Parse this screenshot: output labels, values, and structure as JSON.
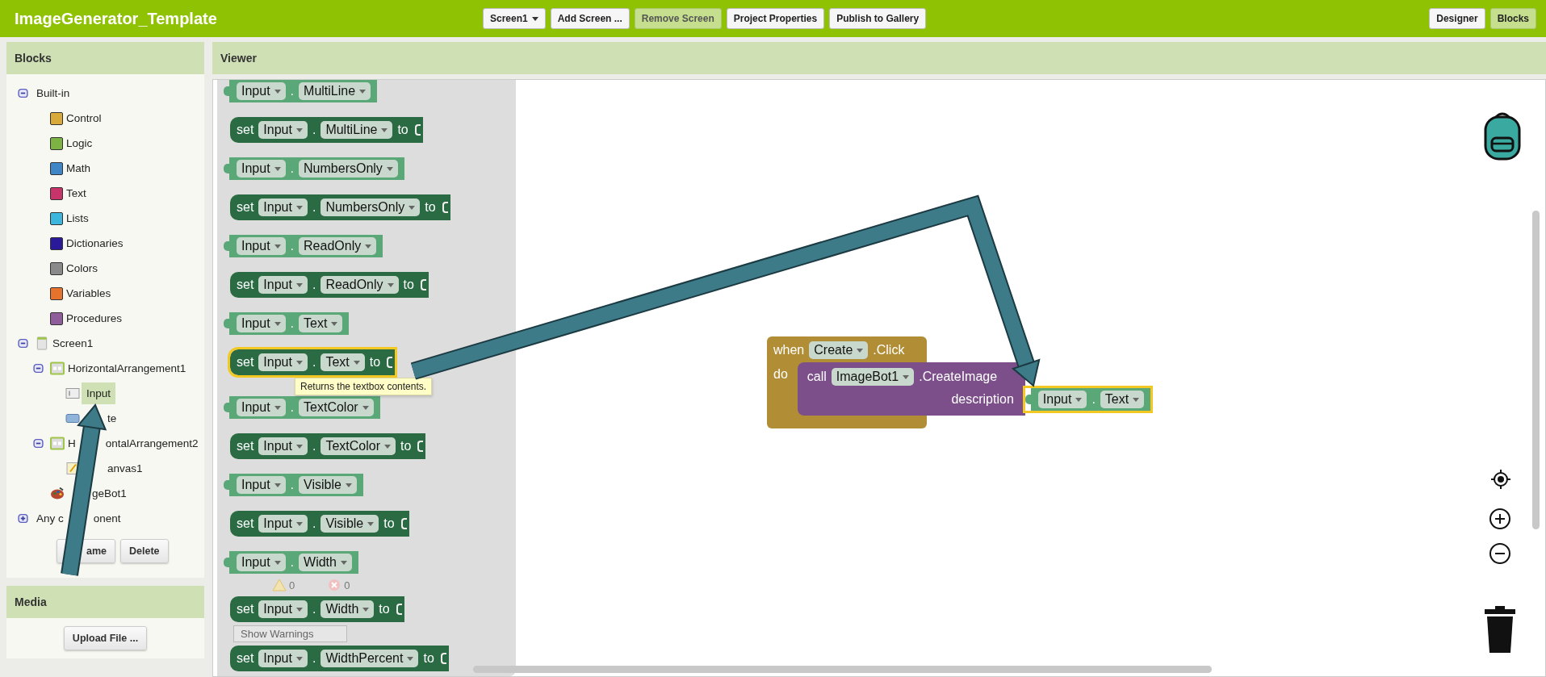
{
  "app_title": "ImageGenerator_Template",
  "toolbar": [
    {
      "label": "Screen1",
      "kind": "dropdown",
      "disabled": false
    },
    {
      "label": "Add Screen ...",
      "kind": "button",
      "disabled": false
    },
    {
      "label": "Remove Screen",
      "kind": "button",
      "disabled": true
    },
    {
      "label": "Project Properties",
      "kind": "button",
      "disabled": false
    },
    {
      "label": "Publish to Gallery",
      "kind": "button",
      "disabled": false
    }
  ],
  "view_switch": [
    {
      "label": "Designer",
      "selected": false
    },
    {
      "label": "Blocks",
      "selected": true
    }
  ],
  "blocks_panel": {
    "title": "Blocks",
    "tree": [
      {
        "label": "Built-in",
        "kind": "group",
        "expanded": true,
        "children": [
          {
            "label": "Control",
            "kind": "category",
            "color": "#d9a93a"
          },
          {
            "label": "Logic",
            "kind": "category",
            "color": "#7cb342"
          },
          {
            "label": "Math",
            "kind": "category",
            "color": "#3f86c6"
          },
          {
            "label": "Text",
            "kind": "category",
            "color": "#c8336a"
          },
          {
            "label": "Lists",
            "kind": "category",
            "color": "#3db6dd"
          },
          {
            "label": "Dictionaries",
            "kind": "category",
            "color": "#2a1a99"
          },
          {
            "label": "Colors",
            "kind": "category",
            "color": "#8a8a8a"
          },
          {
            "label": "Variables",
            "kind": "category",
            "color": "#e6722c"
          },
          {
            "label": "Procedures",
            "kind": "category",
            "color": "#8e5d9a"
          }
        ]
      },
      {
        "label": "Screen1",
        "kind": "screen",
        "expanded": true,
        "selected": false,
        "children": [
          {
            "label": "HorizontalArrangement1",
            "kind": "arrangement",
            "expanded": true,
            "selected": false,
            "children": [
              {
                "label": "Input",
                "kind": "textbox",
                "selected": true
              },
              {
                "label": "te",
                "kind": "button",
                "selected": false,
                "covered_start": true
              }
            ]
          },
          {
            "label": "H",
            "label_rest": "ontalArrangement2",
            "kind": "arrangement",
            "expanded": true,
            "selected": false,
            "children": [
              {
                "label": "anvas1",
                "kind": "canvas",
                "selected": false,
                "covered_start": true
              }
            ]
          },
          {
            "label": "geBot1",
            "kind": "imagebot",
            "selected": false,
            "covered_start": true
          }
        ]
      },
      {
        "label": "Any c",
        "label_rest": "onent",
        "kind": "group",
        "expanded": false
      }
    ],
    "buttons": [
      {
        "label": "ame",
        "covered_start": true
      },
      {
        "label": "Delete",
        "covered_start": false
      }
    ]
  },
  "media_panel": {
    "title": "Media",
    "button": "Upload File ..."
  },
  "viewer": {
    "title": "Viewer",
    "flyout": [
      {
        "kind": "getter",
        "component": "Input",
        "dot": ".",
        "property": "MultiLine",
        "highlighted": false
      },
      {
        "kind": "setter",
        "verb": "set",
        "component": "Input",
        "dot": ".",
        "property": "MultiLine",
        "to": "to",
        "highlighted": false
      },
      {
        "kind": "getter",
        "component": "Input",
        "dot": ".",
        "property": "NumbersOnly",
        "highlighted": false
      },
      {
        "kind": "setter",
        "verb": "set",
        "component": "Input",
        "dot": ".",
        "property": "NumbersOnly",
        "to": "to",
        "highlighted": false
      },
      {
        "kind": "getter",
        "component": "Input",
        "dot": ".",
        "property": "ReadOnly",
        "highlighted": false
      },
      {
        "kind": "setter",
        "verb": "set",
        "component": "Input",
        "dot": ".",
        "property": "ReadOnly",
        "to": "to",
        "highlighted": false
      },
      {
        "kind": "getter",
        "component": "Input",
        "dot": ".",
        "property": "Text",
        "highlighted": false
      },
      {
        "kind": "setter",
        "verb": "set",
        "component": "Input",
        "dot": ".",
        "property": "Text",
        "to": "to",
        "highlighted": true,
        "tooltip": "Returns the textbox contents."
      },
      {
        "kind": "getter",
        "component": "Input",
        "dot": ".",
        "property": "TextColor",
        "highlighted": false
      },
      {
        "kind": "setter",
        "verb": "set",
        "component": "Input",
        "dot": ".",
        "property": "TextColor",
        "to": "to",
        "highlighted": false
      },
      {
        "kind": "getter",
        "component": "Input",
        "dot": ".",
        "property": "Visible",
        "highlighted": false
      },
      {
        "kind": "setter",
        "verb": "set",
        "component": "Input",
        "dot": ".",
        "property": "Visible",
        "to": "to",
        "highlighted": false
      },
      {
        "kind": "getter",
        "component": "Input",
        "dot": ".",
        "property": "Width",
        "highlighted": false
      },
      {
        "kind": "warnings",
        "warning_count": "0",
        "error_count": "0"
      },
      {
        "kind": "setter",
        "verb": "set",
        "component": "Input",
        "dot": ".",
        "property": "Width",
        "to": "to",
        "highlighted": false
      },
      {
        "kind": "button",
        "label": "Show Warnings"
      },
      {
        "kind": "setter",
        "verb": "set",
        "component": "Input",
        "dot": ".",
        "property": "WidthPercent",
        "to": "to",
        "highlighted": false
      }
    ],
    "event_block": {
      "keyword": "when",
      "component": "Create",
      "event": ".Click",
      "do": "do",
      "call": {
        "keyword": "call",
        "component": "ImageBot1",
        "method": ".CreateImage",
        "argument": "description",
        "value": {
          "component": "Input",
          "dot": ".",
          "property": "Text",
          "highlighted": true
        }
      }
    }
  }
}
